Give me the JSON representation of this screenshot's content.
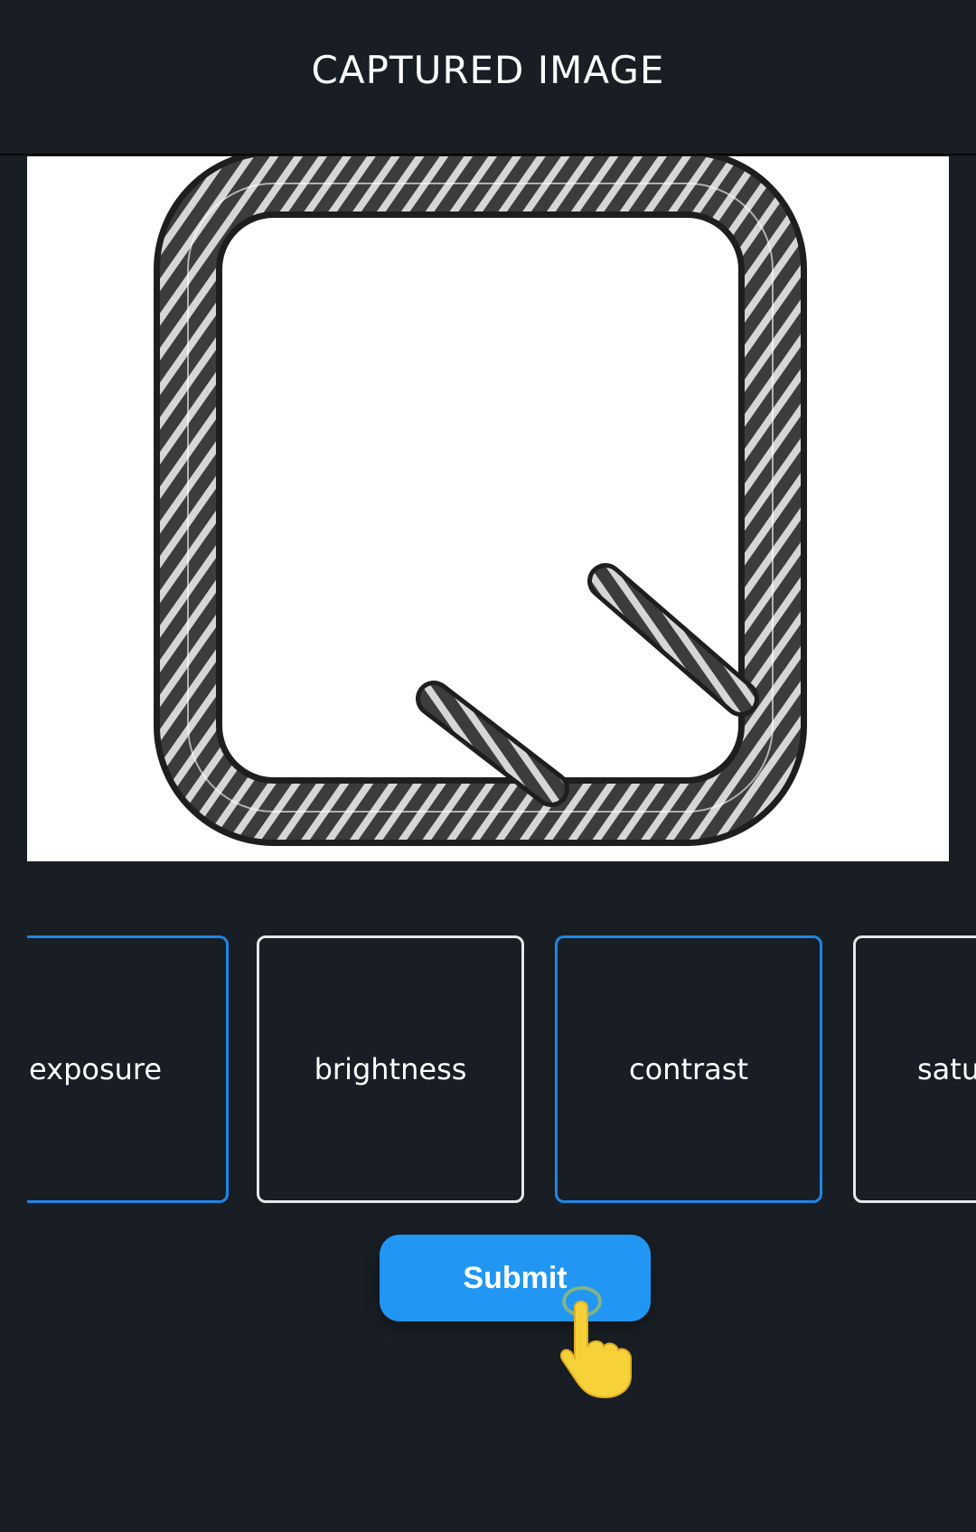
{
  "header": {
    "title": "CAPTURED IMAGE"
  },
  "adjustments": [
    {
      "label": "exposure",
      "selected": true
    },
    {
      "label": "brightness",
      "selected": false
    },
    {
      "label": "contrast",
      "selected": true
    },
    {
      "label": "satu",
      "selected": false
    }
  ],
  "submit": {
    "label": "Submit"
  },
  "colors": {
    "background": "#181e24",
    "accent": "#2196f3",
    "selected_border": "#1f86e6",
    "pointer": "#f7d13a"
  }
}
